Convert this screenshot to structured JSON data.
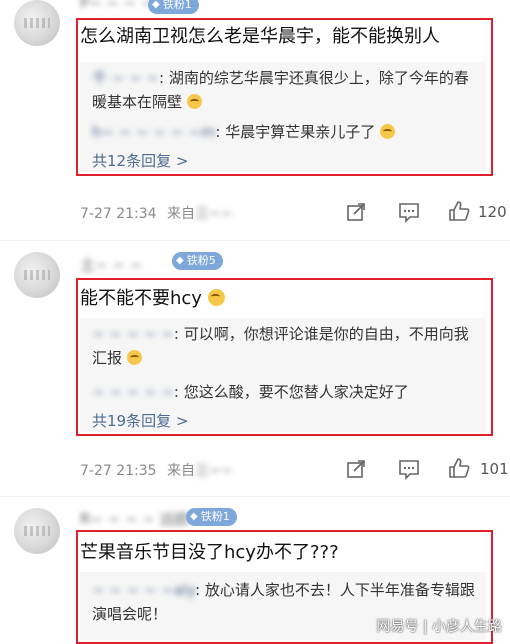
{
  "comments": [
    {
      "user": "P~ ~ ~ ~",
      "badge": "铁粉1",
      "text": "怎么湖南卫视怎么老是华晨宇，能不能换别人",
      "replies": [
        {
          "user": "千 ~ ~ ~",
          "text": ": 湖南的综艺华晨宇还真很少上，除了今年的春暖基本在隔壁"
        },
        {
          "user": "h~ ~ ~ ~ ~ ~m",
          "text": ": 华晨宇算芒果亲儿子了"
        }
      ],
      "more": "共12条回复 >",
      "time": "7-27 21:34",
      "source": "来自",
      "likes": "120"
    },
    {
      "user": "土~ ~ ~",
      "badge": "铁粉5",
      "text": "能不能不要hcy",
      "replies": [
        {
          "user": "~ ~ ~ ~ ~",
          "text": ": 可以啊，你想评论谁是你的自由，不用向我汇报"
        },
        {
          "user": "~ ~ ~ ~ ~",
          "text": ": 您这么酸，要不您替人家决定好了"
        }
      ],
      "more": "共19条回复 >",
      "time": "7-27 21:35",
      "source": "来自",
      "likes": "101"
    },
    {
      "user": "R~ ~ ~ ~ 远欧",
      "badge": "铁粉1",
      "text": "芒果音乐节目没了hcy办不了???",
      "replies": [
        {
          "user": "~ ~ ~ ~ ~aly",
          "text": ": 放心请人家也不去！人下半年准备专辑跟演唱会呢！"
        }
      ]
    }
  ],
  "watermark": "网易号 | 小彦人生路",
  "colors": {
    "highlight_box": "#e0202a",
    "link": "#4d6a92",
    "badge": "#7ea8d9"
  },
  "icons": [
    "share-icon",
    "comment-icon",
    "like-icon",
    "emoji-icon",
    "diamond-icon"
  ]
}
